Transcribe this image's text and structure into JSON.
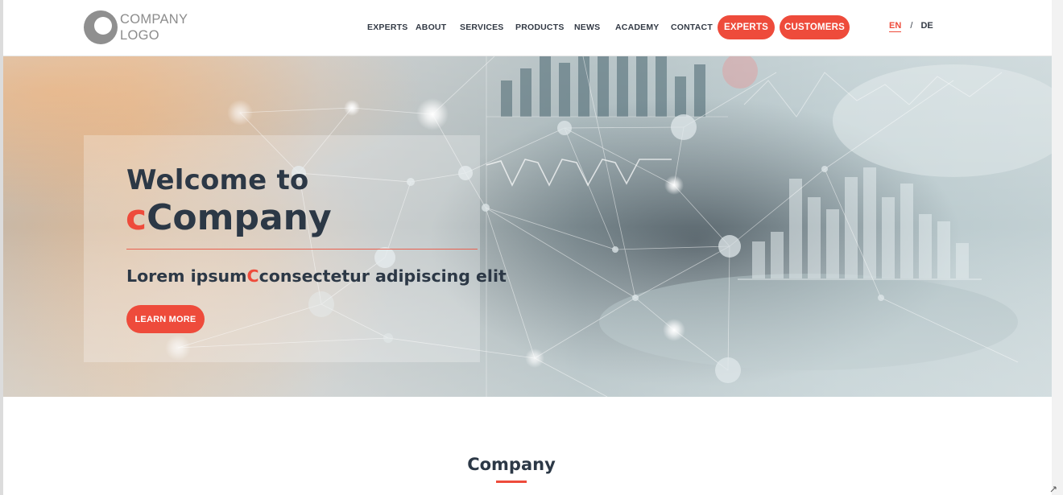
{
  "header": {
    "logo": {
      "line1": "COMPANY",
      "line2": "LOGO"
    },
    "nav": [
      "EXPERTS",
      "ABOUT",
      "SERVICES",
      "PRODUCTS",
      "NEWS",
      "ACADEMY",
      "CONTACT"
    ],
    "buttons": {
      "experts": "EXPERTS",
      "customers": "CUSTOMERS"
    },
    "lang": {
      "active": "EN",
      "separator": "/",
      "other": "DE"
    }
  },
  "hero": {
    "welcome": "Welcome to",
    "brand_accent": "c",
    "brand_rest": "Company",
    "tagline_part1": "Lorem ipsum",
    "tagline_accent": "C",
    "tagline_part2": "consectetur adipiscing elit",
    "cta": "LEARN MORE"
  },
  "section": {
    "title": "Company"
  },
  "colors": {
    "accent": "#ee4b3b",
    "text_dark": "#2c3846",
    "logo_grey": "#8c8c8c"
  }
}
